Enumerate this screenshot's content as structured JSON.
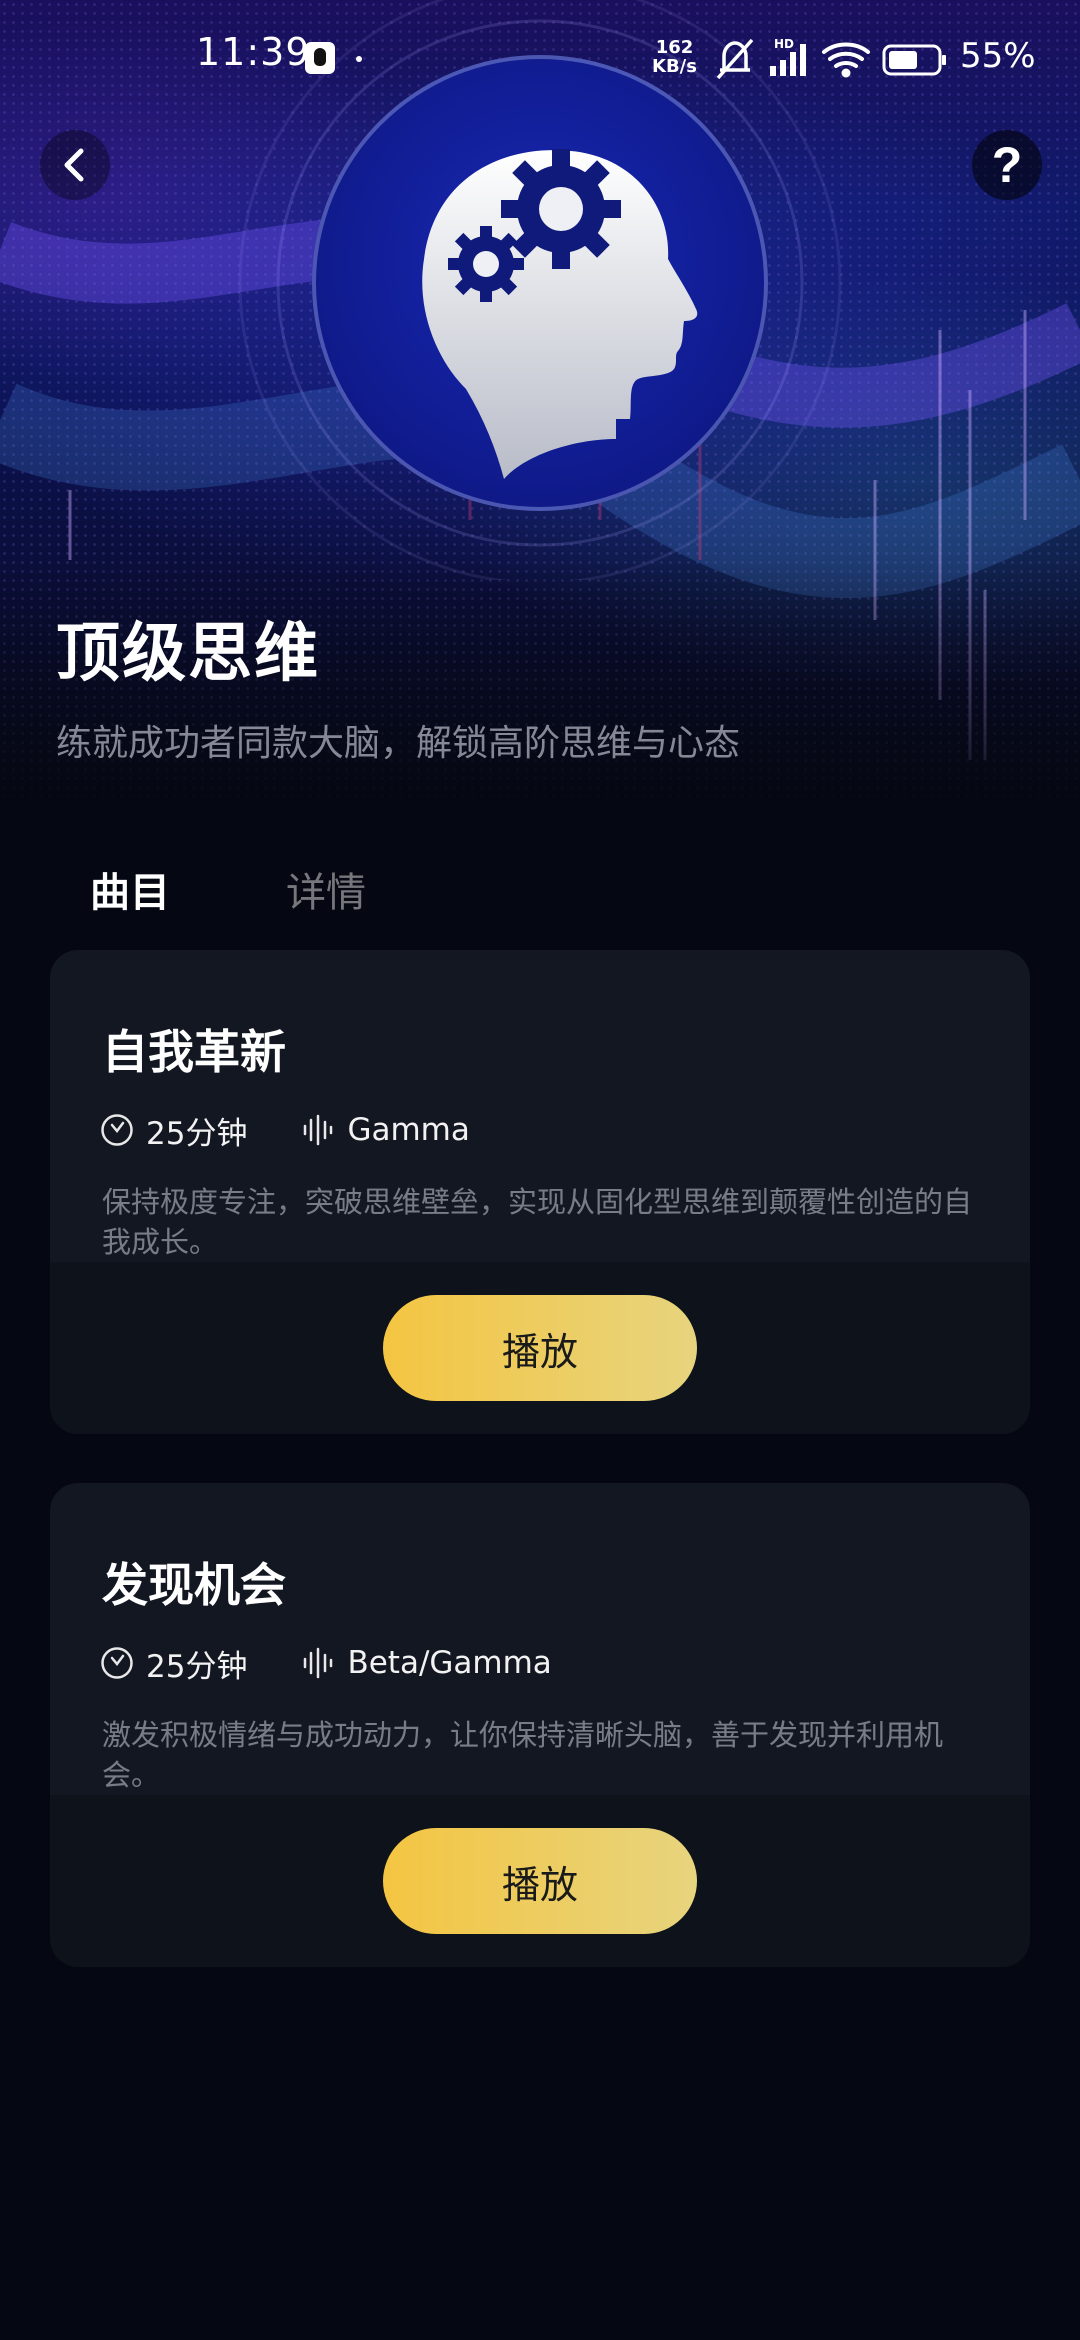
{
  "status_bar": {
    "time": "11:39",
    "net_speed_value": "162",
    "net_speed_unit": "KB/s",
    "signal_label": "HD",
    "battery_percent": "55%",
    "icons": [
      "qq-icon",
      "mute-bell-icon",
      "signal-icon",
      "wifi-icon",
      "battery-icon"
    ]
  },
  "nav": {
    "back_icon": "chevron-left-icon",
    "help_label": "?"
  },
  "hero": {
    "cover_icon": "brain-gears-head-icon",
    "title": "顶级思维",
    "subtitle": "练就成功者同款大脑，解锁高阶思维与心态"
  },
  "tabs": [
    {
      "label": "曲目",
      "active": true
    },
    {
      "label": "详情",
      "active": false
    }
  ],
  "tracks": [
    {
      "title": "自我革新",
      "duration": "25分钟",
      "wave": "Gamma",
      "description": "保持极度专注，突破思维壁垒，实现从固化型思维到颠覆性创造的自我成长。",
      "play_label": "播放"
    },
    {
      "title": "发现机会",
      "duration": "25分钟",
      "wave": "Beta/Gamma",
      "description": "激发积极情绪与成功动力，让你保持清晰头脑，善于发现并利用机会。",
      "play_label": "播放"
    }
  ],
  "colors": {
    "background": "#050812",
    "card": "#131722",
    "play_button_start": "#f4c542",
    "play_button_end": "#e7d47e",
    "cover": "#121f9a"
  }
}
